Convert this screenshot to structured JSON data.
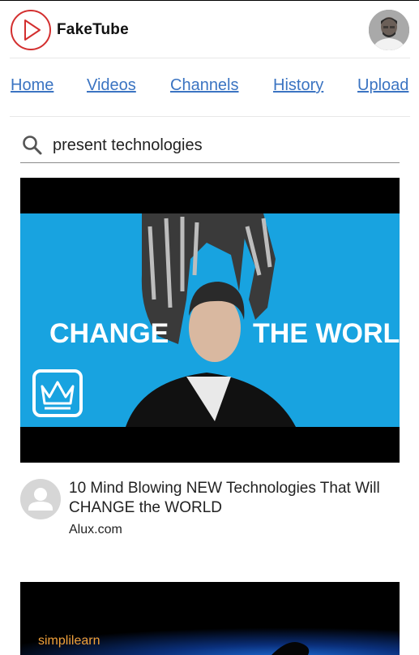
{
  "header": {
    "brand": "FakeTube",
    "brand_color": "#d32f2f"
  },
  "nav": {
    "items": [
      "Home",
      "Videos",
      "Channels",
      "History",
      "Upload"
    ],
    "link_color": "#3b74c2"
  },
  "search": {
    "value": "present technologies",
    "icon": "search-icon"
  },
  "videos": [
    {
      "thumbnail_text_left": "CHANGE",
      "thumbnail_text_right": "THE WORLD",
      "title": "10 Mind Blowing NEW Technologies That Will CHANGE the WORLD",
      "channel": "Alux.com"
    },
    {
      "thumbnail_brand": "simplilearn"
    }
  ]
}
